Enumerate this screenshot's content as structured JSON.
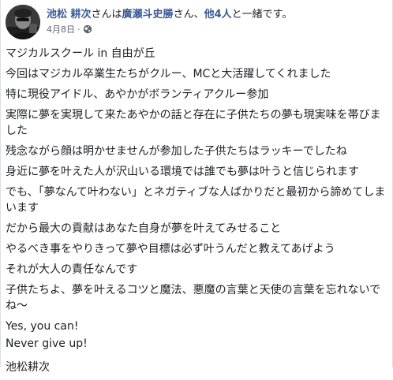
{
  "post": {
    "author": "池松 耕次",
    "with_text": "さんは",
    "tagged_main": "廣瀬斗史勝",
    "with_text2": "さん、",
    "tagged_others": "他4人",
    "with_text3": "と一緒です。",
    "date": "4月8日",
    "dot": "·",
    "privacy_icon": "globe-icon"
  },
  "body": {
    "lines": [
      "マジカルスクール in 自由が丘",
      "今回はマジカル卒業生たちがクルー、MCと大活躍してくれました",
      "特に現役アイドル、あやかがボランティアクルー参加",
      "実際に夢を実現して来たあやかの話と存在に子供たちの夢も現実味を帯びました",
      "残念ながら顔は明かせませんが参加した子供たちはラッキーでしたね",
      "身近に夢を叶えた人が沢山いる環境では誰でも夢は叶うと信じられます",
      "でも、「夢なんて叶わない」とネガティブな人ばかりだと最初から諦めてしまいます",
      "だから最大の貢献はあなた自身が夢を叶えてみせること",
      "やるべき事をやりきって夢や目標は必ず叶うんだと教えてあげよう",
      "それが大人の責任なんです",
      "子供たちよ、夢を叶えるコツと魔法、悪魔の言葉と天使の言葉を忘れないでね〜",
      "Yes, you can!",
      "Never give up!",
      "池松耕次"
    ]
  }
}
